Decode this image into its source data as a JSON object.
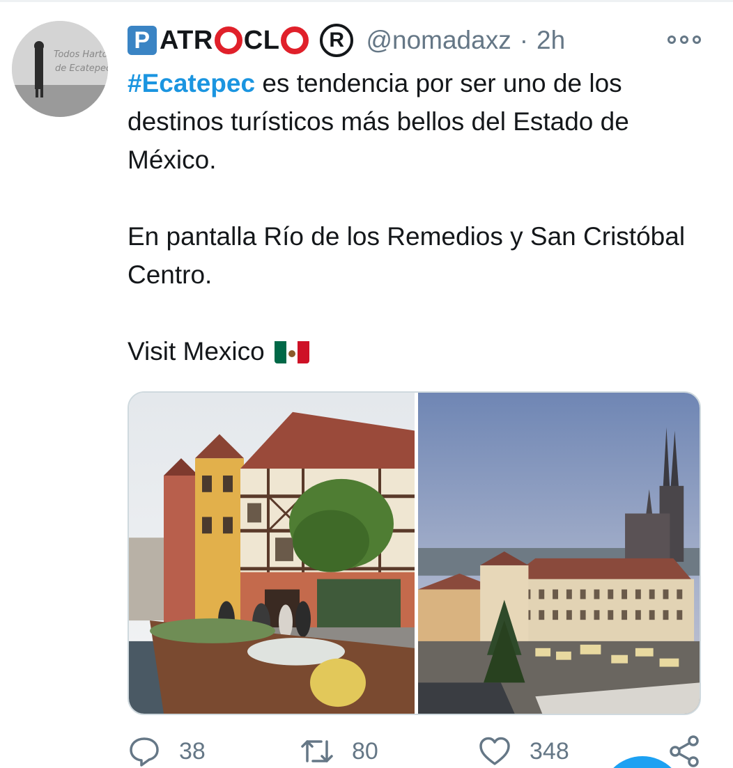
{
  "tweet": {
    "author_name": {
      "p_letter": "P",
      "seg1": "ATR",
      "seg2": "CL",
      "reg_symbol": "R"
    },
    "handle": "@nomadaxz",
    "separator": "·",
    "time": "2h",
    "text": {
      "hashtag": "#Ecatepec",
      "line1_rest": " es tendencia por ser uno de los destinos turísticos más bellos del Estado de México.",
      "line2": "En pantalla Río de los Remedios y San Cristóbal Centro.",
      "line3": "Visit Mexico"
    },
    "flag_icon": "mexico-flag-emoji"
  },
  "actions": {
    "reply_count": "38",
    "retweet_count": "80",
    "like_count": "348"
  },
  "icons": {
    "more": "more-options-icon",
    "reply": "reply-icon",
    "retweet": "retweet-icon",
    "like": "heart-icon",
    "share": "share-icon"
  },
  "colors": {
    "hashtag": "#1b95e0",
    "secondary_text": "#657786",
    "accent": "#1da1f2",
    "logo_blue": "#3a84c4",
    "logo_red": "#e0202a"
  }
}
